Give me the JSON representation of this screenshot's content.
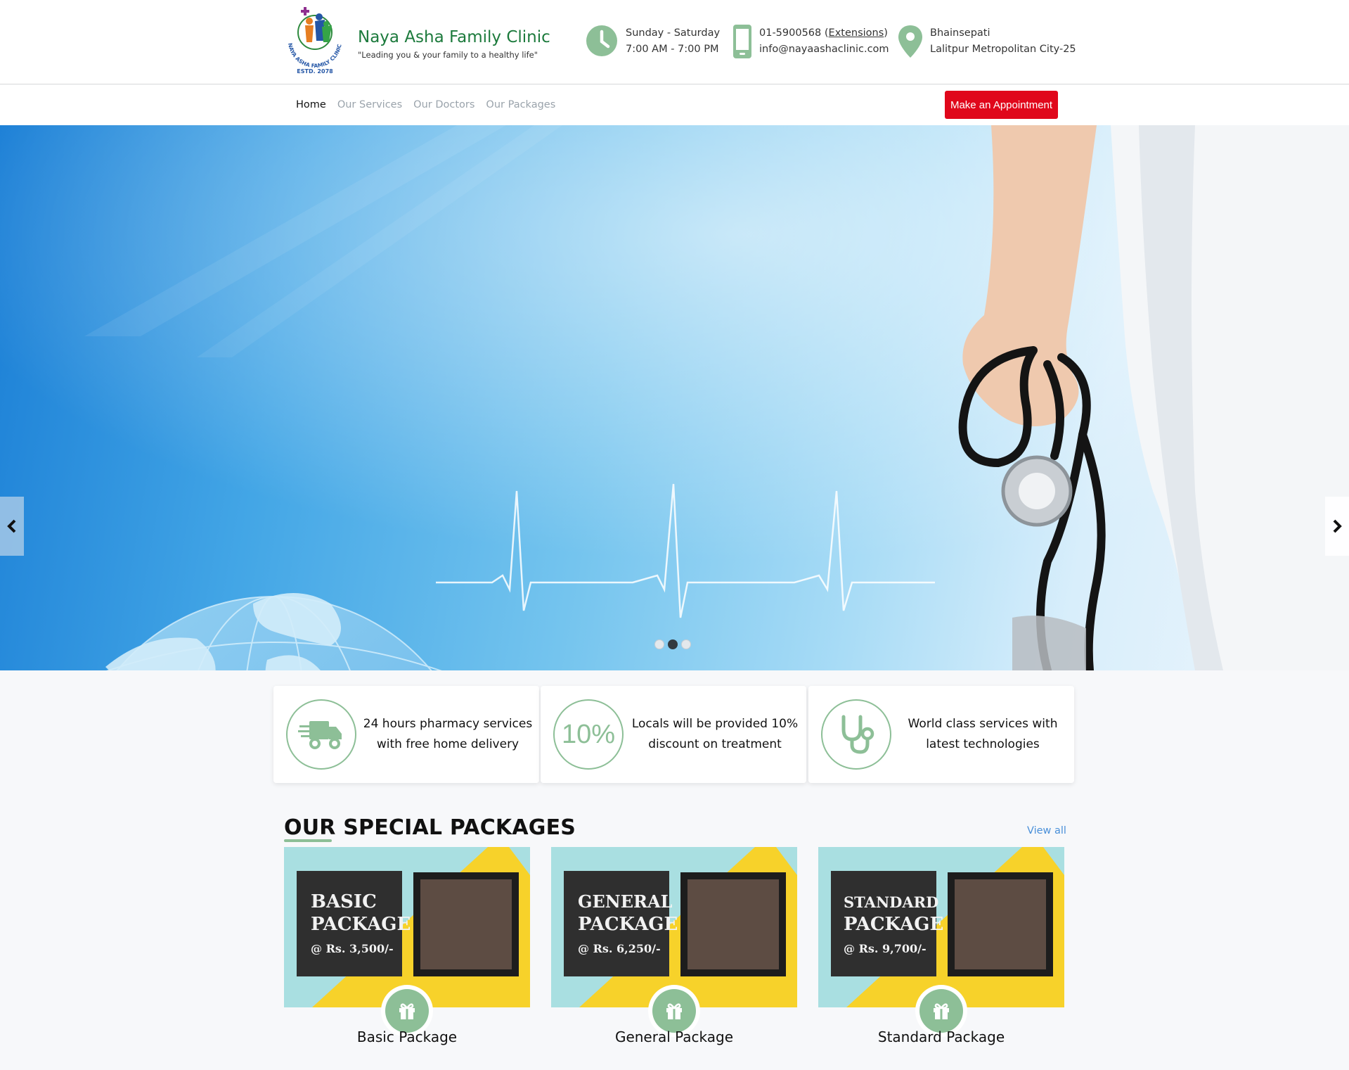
{
  "header": {
    "brand_name": "Naya Asha Family Clinic",
    "tagline": "\"Leading you & your family to a healthy life\"",
    "logo_text": "NAYA ASHA FAMILY CLINIC",
    "logo_estd": "ESTD. 2078",
    "hours": {
      "days": "Sunday - Saturday",
      "time": "7:00 AM - 7:00 PM",
      "icon": "clock-icon"
    },
    "contact": {
      "phone": "01-5900568",
      "extensions": "Extensions",
      "email": "info@nayaashaclinic.com",
      "icon": "mobile-phone-icon"
    },
    "address": {
      "line1": "Bhainsepati",
      "line2": "Lalitpur Metropolitan City-25",
      "icon": "map-pin-icon"
    }
  },
  "nav": {
    "items": [
      {
        "label": "Home",
        "active": true
      },
      {
        "label": "Our Services",
        "active": false
      },
      {
        "label": "Our Doctors",
        "active": false
      },
      {
        "label": "Our Packages",
        "active": false
      }
    ],
    "cta": "Make an Appointment"
  },
  "hero": {
    "slide_count": 3,
    "active_slide": 2,
    "prev_icon": "chevron-left-icon",
    "next_icon": "chevron-right-icon"
  },
  "features": [
    {
      "line1": "24 hours pharmacy services",
      "line2": "with free home delivery",
      "icon": "delivery-truck-icon"
    },
    {
      "line1": "Locals will be provided 10%",
      "line2": "discount on treatment",
      "icon": "percent-icon",
      "icon_text": "10%"
    },
    {
      "line1": "World class services with",
      "line2": "latest technologies",
      "icon": "stethoscope-icon"
    }
  ],
  "packages_section": {
    "title": "OUR SPECIAL PACKAGES",
    "view_all": "View all",
    "items": [
      {
        "name": "Basic Package",
        "box_line1": "BASIC",
        "box_line2": "PACKAGE",
        "price": "@ Rs. 3,500/-",
        "icon": "gift-icon"
      },
      {
        "name": "General Package",
        "box_line1": "GENERAL",
        "box_line2": "PACKAGE",
        "price": "@ Rs. 6,250/-",
        "icon": "gift-icon"
      },
      {
        "name": "Standard Package",
        "box_line1": "STANDARD",
        "box_line2": "PACKAGE",
        "price": "@ Rs. 9,700/-",
        "icon": "gift-icon"
      }
    ]
  },
  "colors": {
    "brand_green": "#1c7a3c",
    "accent_green": "#8dbf97",
    "cta_red": "#e0071b",
    "link_blue": "#4a90d9"
  }
}
